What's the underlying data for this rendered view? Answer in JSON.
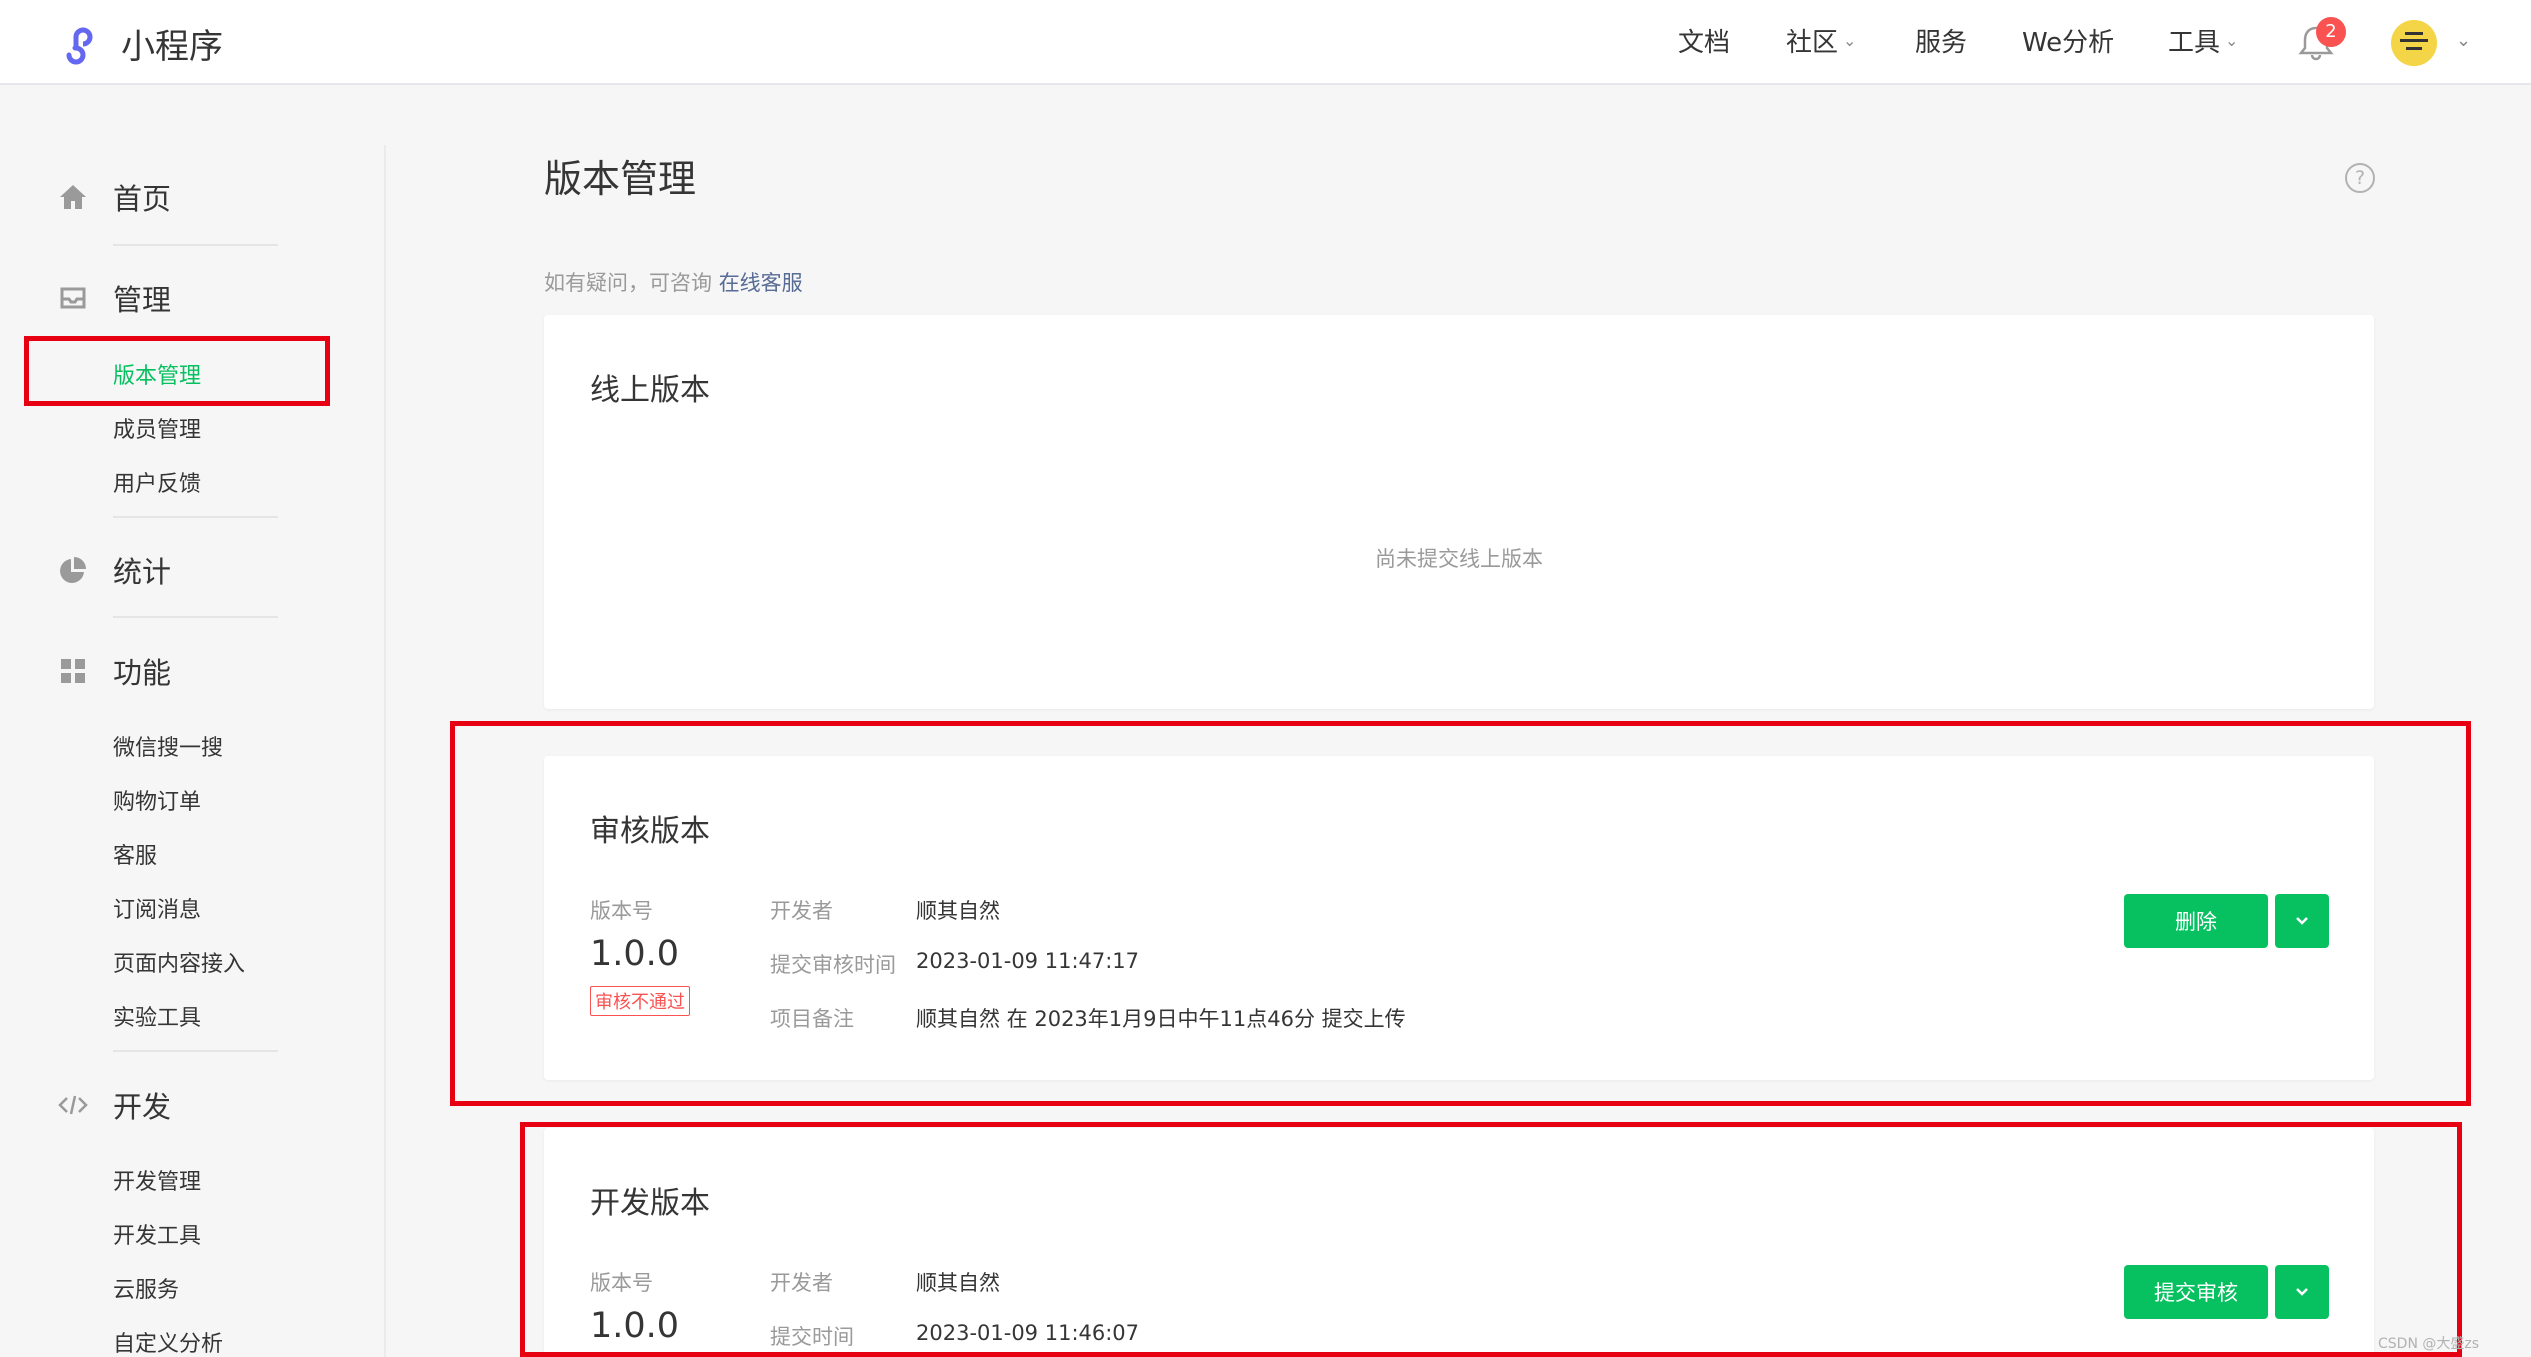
{
  "app": {
    "title": "小程序"
  },
  "topnav": [
    {
      "label": "文档",
      "has_chevron": false
    },
    {
      "label": "社区",
      "has_chevron": true
    },
    {
      "label": "服务",
      "has_chevron": false
    },
    {
      "label": "We分析",
      "has_chevron": false
    },
    {
      "label": "工具",
      "has_chevron": true
    }
  ],
  "notifications": {
    "count": "2"
  },
  "sidebar": {
    "home": "首页",
    "manage": {
      "label": "管理",
      "items": [
        "版本管理",
        "成员管理",
        "用户反馈"
      ]
    },
    "stats": "统计",
    "features": {
      "label": "功能",
      "items": [
        "微信搜一搜",
        "购物订单",
        "客服",
        "订阅消息",
        "页面内容接入",
        "实验工具"
      ]
    },
    "dev": {
      "label": "开发",
      "items": [
        "开发管理",
        "开发工具",
        "云服务",
        "自定义分析"
      ]
    }
  },
  "page": {
    "title": "版本管理",
    "hint_prefix": "如有疑问，可咨询",
    "hint_link": "在线客服"
  },
  "online_version": {
    "title": "线上版本",
    "empty_text": "尚未提交线上版本"
  },
  "review_version": {
    "title": "审核版本",
    "version_label": "版本号",
    "version": "1.0.0",
    "status": "审核不通过",
    "developer_label": "开发者",
    "developer": "顺其自然",
    "time_label": "提交审核时间",
    "time": "2023-01-09 11:47:17",
    "note_label": "项目备注",
    "note": "顺其自然 在 2023年1月9日中午11点46分 提交上传",
    "action": "删除"
  },
  "dev_version": {
    "title": "开发版本",
    "version_label": "版本号",
    "version": "1.0.0",
    "developer_label": "开发者",
    "developer": "顺其自然",
    "time_label": "提交时间",
    "time": "2023-01-09 11:46:07",
    "action": "提交审核"
  },
  "watermark": "CSDN @大盛zs",
  "colors": {
    "accent": "#07c160",
    "highlight": "#e60012",
    "link": "#576b95"
  }
}
